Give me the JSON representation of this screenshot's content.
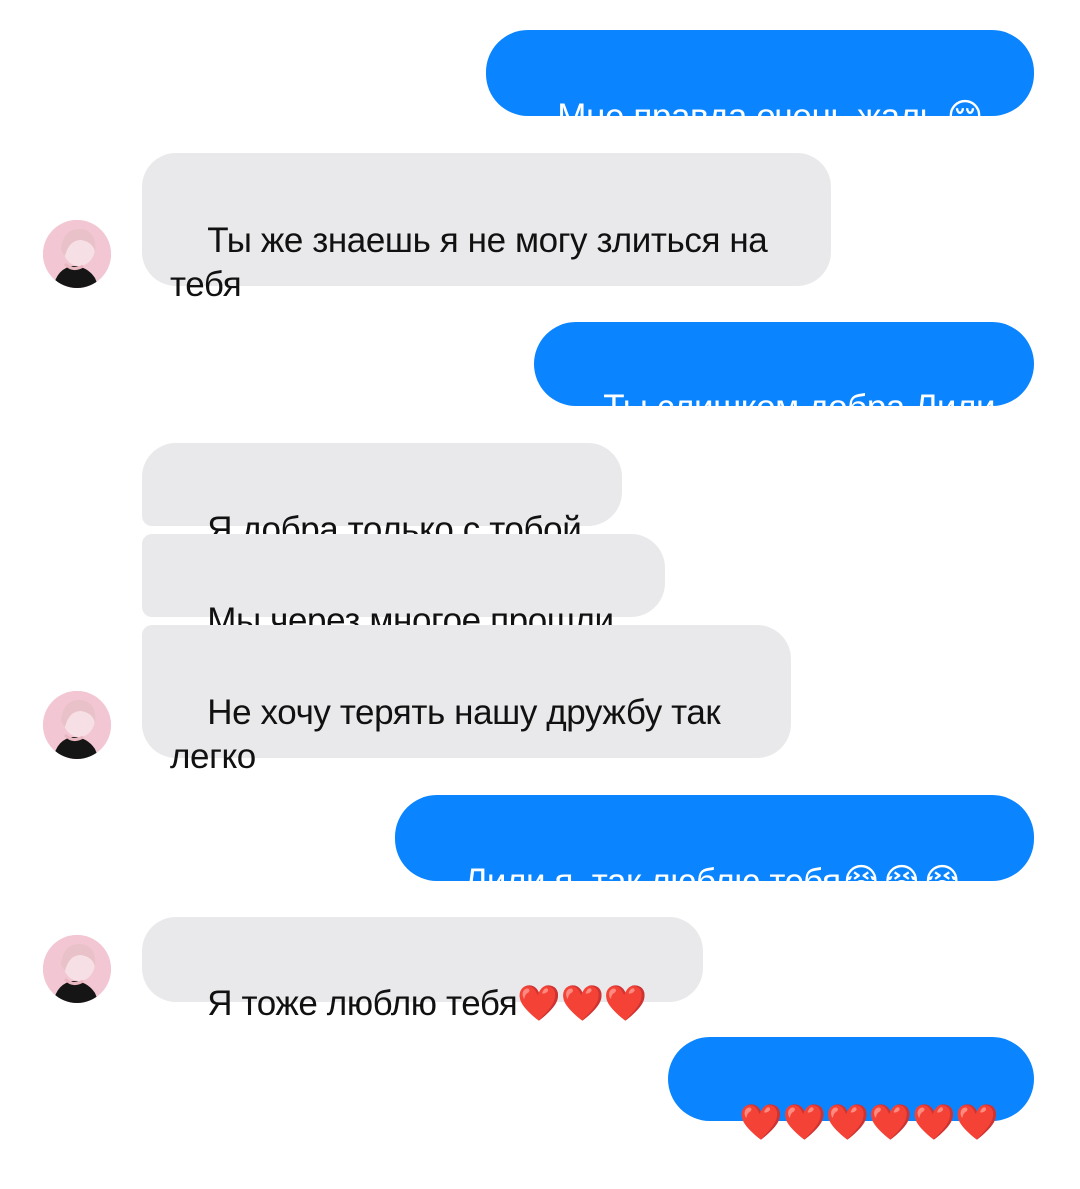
{
  "conversation": {
    "messages": [
      {
        "sender": "me",
        "text": "Мне правда очень жаль 😔"
      },
      {
        "sender": "contact",
        "text": "Ты же знаешь я не могу злиться на тебя"
      },
      {
        "sender": "me",
        "text": "Ты слишком добра Лили"
      },
      {
        "sender": "contact",
        "text": "Я добра только с тобой"
      },
      {
        "sender": "contact",
        "text": "Мы через многое прошли"
      },
      {
        "sender": "contact",
        "text": "Не хочу терять нашу дружбу так легко"
      },
      {
        "sender": "me",
        "text": "Лили я  так люблю тебя😭😭😭"
      },
      {
        "sender": "contact",
        "text": "Я тоже люблю тебя❤️❤️❤️"
      },
      {
        "sender": "me",
        "text": "❤️❤️❤️❤️❤️❤️"
      }
    ]
  },
  "colors": {
    "outgoing_bubble": "#0a84ff",
    "incoming_bubble": "#e9e9eb",
    "outgoing_text": "#ffffff",
    "incoming_text": "#111111"
  },
  "icons": {
    "avatar": "contact-avatar-photo"
  }
}
